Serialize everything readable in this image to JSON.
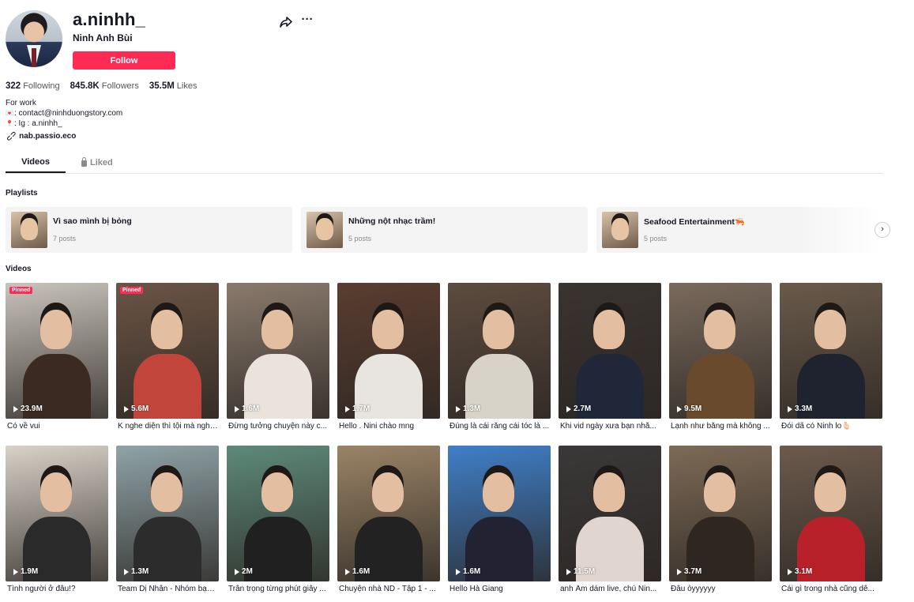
{
  "profile": {
    "username": "a.ninhh_",
    "nickname": "Ninh Anh Bùi",
    "follow_label": "Follow"
  },
  "stats": [
    {
      "value": "322",
      "label": "Following"
    },
    {
      "value": "845.8K",
      "label": "Followers"
    },
    {
      "value": "35.5M",
      "label": "Likes"
    }
  ],
  "bio": {
    "line1": "For work",
    "line2": ": contact@ninhduongstory.com",
    "line3": ": Ig : a.ninhh_",
    "link": "nab.passio.eco"
  },
  "tabs": {
    "videos": "Videos",
    "liked": "Liked"
  },
  "sections": {
    "playlists": "Playlists",
    "videos": "Videos"
  },
  "playlists": [
    {
      "title": "Vì sao mình bị bỏng",
      "count": "7 posts"
    },
    {
      "title": "Những nột nhạc trầm!",
      "count": "5 posts"
    },
    {
      "title": "Seafood Entertainment🦐",
      "count": "5 posts"
    }
  ],
  "videos": [
    {
      "views": "23.9M",
      "caption": "Có về vui",
      "pinned": "Pinned",
      "bg": "#c9c3bc",
      "fig": "#3a2a22"
    },
    {
      "views": "5.6M",
      "caption": "K nghe diện thì tội mà nghe...",
      "pinned": "Pinned",
      "bg": "#6b5444",
      "fig": "#c2453b"
    },
    {
      "views": "1.6M",
      "caption": "Đừng tưởng chuyện này c...",
      "bg": "#8a7a6c",
      "fig": "#e9e3dc"
    },
    {
      "views": "1.7M",
      "caption": "Hello . Nini chào mng",
      "bg": "#5a3d30",
      "fig": "#e8e4df"
    },
    {
      "views": "1.3M",
      "caption": "Đúng là cái răng cái tóc là ...",
      "bg": "#5d4b3e",
      "fig": "#d8d3c8"
    },
    {
      "views": "2.7M",
      "caption": "Khi vid ngày xưa bạn nhắ...",
      "bg": "#3a3431",
      "fig": "#1f2738"
    },
    {
      "views": "9.5M",
      "caption": "Lạnh như băng mà không ...",
      "bg": "#7a6a5c",
      "fig": "#6a4a2c"
    },
    {
      "views": "3.3M",
      "caption": "Đói dã có Ninh lo🫰🏻",
      "bg": "#6a5a4a",
      "fig": "#1f2330"
    },
    {
      "views": "1.9M",
      "caption": "Tình người ở đâu!?",
      "bg": "#d8d2c8",
      "fig": "#2a2a2a"
    },
    {
      "views": "1.3M",
      "caption": "Team Dị Nhân - Nhóm bạn ...",
      "bg": "#8fa3a6",
      "fig": "#2c2c2c"
    },
    {
      "views": "2M",
      "caption": "Trân trọng từng phút giây ...",
      "bg": "#5d8a7a",
      "fig": "#202020"
    },
    {
      "views": "1.6M",
      "caption": "Chuyện nhà ND - Tập 1 - ...",
      "bg": "#9a8466",
      "fig": "#222"
    },
    {
      "views": "1.6M",
      "caption": "Hello Hà Giang",
      "bg": "#3f7fc8",
      "fig": "#223"
    },
    {
      "views": "11.5M",
      "caption": "anh Âm dám live, chú Nin...",
      "bg": "#3a3838",
      "fig": "#e0d6cf"
    },
    {
      "views": "3.7M",
      "caption": "Đâu òyyyyyy",
      "bg": "#7d6a56",
      "fig": "#2e2621"
    },
    {
      "views": "3.1M",
      "caption": "Cái gì trong nhà cũng dê...",
      "bg": "#6c5a4c",
      "fig": "#b8202a"
    }
  ]
}
